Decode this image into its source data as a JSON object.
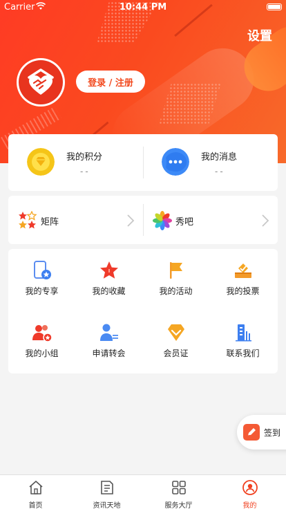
{
  "status_bar": {
    "carrier": "Carrier",
    "time": "10:44 PM"
  },
  "header": {
    "settings_label": "设置",
    "login_label": "登录 / 注册"
  },
  "points": {
    "score_label": "我的积分",
    "score_value": "--",
    "messages_label": "我的消息",
    "messages_value": "--"
  },
  "quick_links": {
    "matrix_label": "矩阵",
    "show_label": "秀吧"
  },
  "grid": {
    "items": [
      {
        "label": "我的专享",
        "icon": "phone-star-icon"
      },
      {
        "label": "我的收藏",
        "icon": "star-icon"
      },
      {
        "label": "我的活动",
        "icon": "flag-icon"
      },
      {
        "label": "我的投票",
        "icon": "ballot-box-icon"
      },
      {
        "label": "我的小组",
        "icon": "group-icon"
      },
      {
        "label": "申请转会",
        "icon": "user-transfer-icon"
      },
      {
        "label": "会员证",
        "icon": "diamond-icon"
      },
      {
        "label": "联系我们",
        "icon": "building-icon"
      }
    ]
  },
  "sign_in": {
    "label": "签到"
  },
  "tabs": [
    {
      "label": "首页",
      "icon": "home-icon"
    },
    {
      "label": "资讯天地",
      "icon": "news-icon"
    },
    {
      "label": "服务大厅",
      "icon": "services-grid-icon"
    },
    {
      "label": "我的",
      "icon": "profile-icon",
      "active": true
    }
  ],
  "colors": {
    "accent": "#f24a1f",
    "hero_start": "#ff3b24",
    "hero_end": "#f86a2a"
  }
}
